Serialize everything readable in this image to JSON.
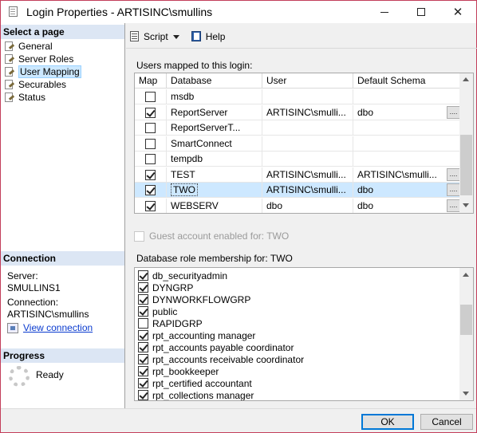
{
  "window": {
    "title": "Login Properties - ARTISINC\\smullins",
    "min_label": "—",
    "max_label": "☐",
    "close_label": "✕"
  },
  "left": {
    "select_page_header": "Select a page",
    "pages": [
      {
        "label": "General",
        "selected": false
      },
      {
        "label": "Server Roles",
        "selected": false
      },
      {
        "label": "User Mapping",
        "selected": true
      },
      {
        "label": "Securables",
        "selected": false
      },
      {
        "label": "Status",
        "selected": false
      }
    ],
    "connection_header": "Connection",
    "server_label": "Server:",
    "server_value": "SMULLINS1",
    "connection_label": "Connection:",
    "connection_value": "ARTISINC\\smullins",
    "view_connection": "View connection",
    "progress_header": "Progress",
    "progress_status": "Ready"
  },
  "toolbar": {
    "script_label": "Script",
    "help_label": "Help"
  },
  "users_mapped": {
    "label": "Users mapped to this login:",
    "columns": [
      "Map",
      "Database",
      "User",
      "Default Schema"
    ],
    "rows": [
      {
        "map": false,
        "database": "msdb",
        "user": "",
        "schema": "",
        "button": false,
        "selected": false
      },
      {
        "map": true,
        "database": "ReportServer",
        "user": "ARTISINC\\smulli...",
        "schema": "dbo",
        "button": true,
        "selected": false
      },
      {
        "map": false,
        "database": "ReportServerT...",
        "user": "",
        "schema": "",
        "button": false,
        "selected": false
      },
      {
        "map": false,
        "database": "SmartConnect",
        "user": "",
        "schema": "",
        "button": false,
        "selected": false
      },
      {
        "map": false,
        "database": "tempdb",
        "user": "",
        "schema": "",
        "button": false,
        "selected": false
      },
      {
        "map": true,
        "database": "TEST",
        "user": "ARTISINC\\smulli...",
        "schema": "ARTISINC\\smulli...",
        "button": true,
        "selected": false
      },
      {
        "map": true,
        "database": "TWO",
        "user": "ARTISINC\\smulli...",
        "schema": "dbo",
        "button": true,
        "selected": true
      },
      {
        "map": true,
        "database": "WEBSERV",
        "user": "dbo",
        "schema": "dbo",
        "button": true,
        "selected": false
      }
    ],
    "ellipsis": "...."
  },
  "guest": {
    "label": "Guest account enabled for: TWO",
    "checked": false,
    "enabled": false
  },
  "roles": {
    "label": "Database role membership for: TWO",
    "items": [
      {
        "label": "db_securityadmin",
        "checked": true
      },
      {
        "label": "DYNGRP",
        "checked": true
      },
      {
        "label": "DYNWORKFLOWGRP",
        "checked": true
      },
      {
        "label": "public",
        "checked": true
      },
      {
        "label": "RAPIDGRP",
        "checked": false
      },
      {
        "label": "rpt_accounting manager",
        "checked": true
      },
      {
        "label": "rpt_accounts payable coordinator",
        "checked": true
      },
      {
        "label": "rpt_accounts receivable coordinator",
        "checked": true
      },
      {
        "label": "rpt_bookkeeper",
        "checked": true
      },
      {
        "label": "rpt_certified accountant",
        "checked": true
      },
      {
        "label": "rpt_collections manager",
        "checked": true
      }
    ]
  },
  "buttons": {
    "ok": "OK",
    "cancel": "Cancel"
  }
}
